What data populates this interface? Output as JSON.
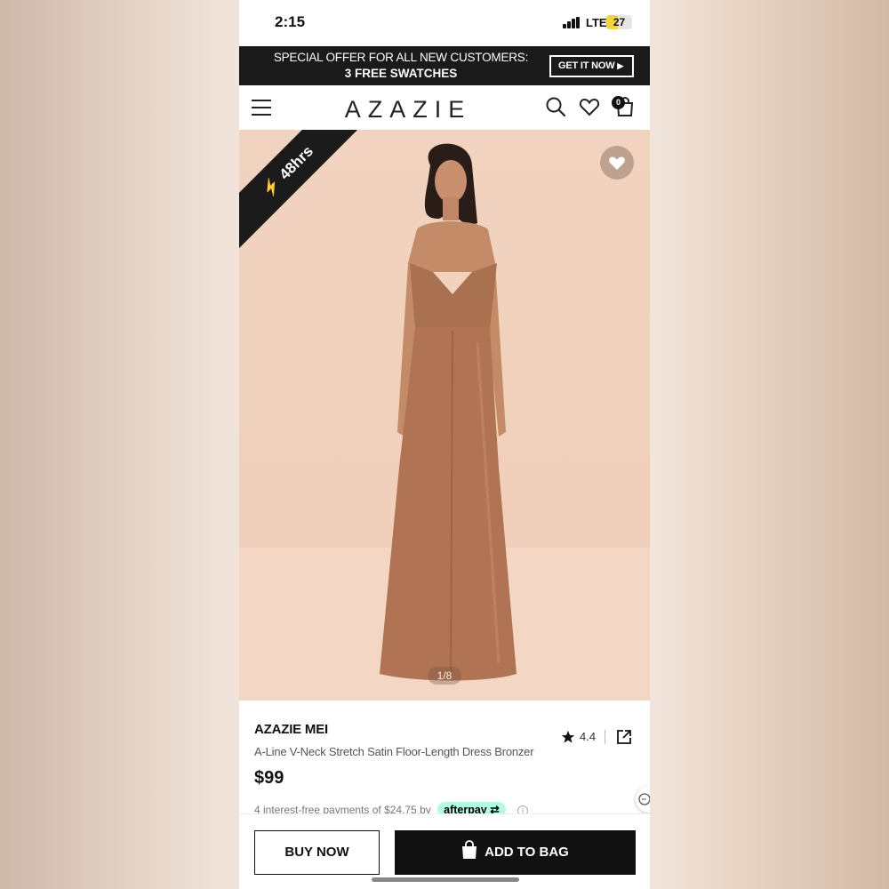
{
  "status_bar": {
    "time": "2:15",
    "network": "LTE",
    "battery": "27"
  },
  "promo": {
    "line1": "SPECIAL OFFER FOR ALL NEW CUSTOMERS:",
    "line2": "3 FREE SWATCHES",
    "cta": "GET IT NOW"
  },
  "header": {
    "logo": "AZAZIE",
    "cart_count": "0"
  },
  "hero": {
    "ribbon": "48hrs",
    "image_counter": "1/8"
  },
  "product": {
    "brand": "AZAZIE MEI",
    "name": "A-Line V-Neck Stretch Satin Floor-Length Dress Bronzer",
    "price": "$99",
    "rating": "4.4",
    "installments": "4 interest-free payments of $24.75 by",
    "afterpay_label": "afterpay"
  },
  "actions": {
    "buy_now": "BUY NOW",
    "add_to_bag": "ADD TO BAG"
  },
  "colors": {
    "dress": "#b57a5a",
    "backdrop": "#f1d3bf",
    "afterpay_mint": "#b2fce4"
  }
}
